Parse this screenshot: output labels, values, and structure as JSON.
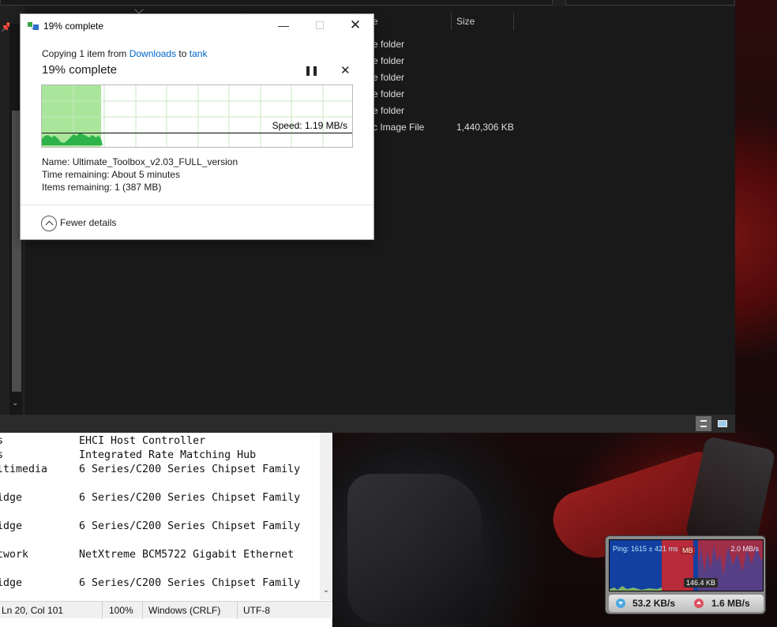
{
  "explorer": {
    "columns": {
      "type_header": "e",
      "size_header": "Size"
    },
    "rows": [
      {
        "type": "e folder",
        "size": ""
      },
      {
        "type": "e folder",
        "size": ""
      },
      {
        "type": "e folder",
        "size": ""
      },
      {
        "type": "e folder",
        "size": ""
      },
      {
        "type": "e folder",
        "size": ""
      },
      {
        "type": "c Image File",
        "size": "1,440,306 KB"
      }
    ]
  },
  "copy_dialog": {
    "title": "19% complete",
    "copying_prefix": "Copying 1 item from ",
    "source": "Downloads",
    "copying_mid": " to ",
    "destination": "tank",
    "headline": "19% complete",
    "progress_percent": 19,
    "speed": "Speed: 1.19 MB/s",
    "name_label": "Name:",
    "name_value": "Ultimate_Toolbox_v2.03_FULL_version",
    "time_label": "Time remaining:",
    "time_value": "About 5 minutes",
    "items_label": "Items remaining:",
    "items_value": "1 (387 MB)",
    "fewer_details": "Fewer details",
    "colors": {
      "progress_fill": "#a9e69b",
      "speed_area": "#2db34a",
      "link": "#0066cc"
    }
  },
  "notepad": {
    "lines": [
      {
        "left": "s",
        "right": "EHCI Host Controller"
      },
      {
        "left": "s",
        "right": "Integrated Rate Matching Hub"
      },
      {
        "left": "ltimedia",
        "right": "6 Series/C200 Series Chipset Family"
      },
      {
        "left": "",
        "right": ""
      },
      {
        "left": "idge",
        "right": "6 Series/C200 Series Chipset Family"
      },
      {
        "left": "",
        "right": ""
      },
      {
        "left": "idge",
        "right": "6 Series/C200 Series Chipset Family"
      },
      {
        "left": "",
        "right": ""
      },
      {
        "left": "twork",
        "right": "NetXtreme BCM5722 Gigabit Ethernet"
      },
      {
        "left": "",
        "right": ""
      },
      {
        "left": "idge",
        "right": "6 Series/C200 Series Chipset Family"
      }
    ],
    "status": {
      "position": "Ln 20, Col 101",
      "zoom": "100%",
      "line_ending": "Windows (CRLF)",
      "encoding": "UTF-8"
    }
  },
  "net_meter": {
    "ping": "Ping: 1615 ± 421 ms",
    "mb_tag": "MB",
    "max_rate": "2.0 MB/s",
    "mid_value": "146.4 KB",
    "download": "53.2 KB/s",
    "upload": "1.6 MB/s",
    "colors": {
      "graph_bg": "#1240a0",
      "upload_area": "#b92b3a"
    }
  }
}
